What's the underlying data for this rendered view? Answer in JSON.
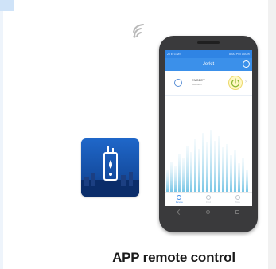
{
  "caption": "APP remote control",
  "phone": {
    "screen_title": "Jerkit",
    "status_left": "ZTE GMS",
    "status_right": "5:00 PM 100%",
    "device_name": "ENGBEY",
    "device_subtitle": "Bluetooth",
    "tabs": [
      {
        "label": "Device",
        "active": true
      },
      {
        "label": "Find",
        "active": false
      },
      {
        "label": "Time",
        "active": false
      }
    ]
  },
  "colors": {
    "accent": "#3b90ea",
    "tile": "#1a56b3",
    "phone_body": "#3a3a3c"
  },
  "icons": {
    "wifi": "wifi-signal-icon",
    "tile": "heater-device-icon",
    "power": "power-icon",
    "settings": "settings-icon"
  }
}
